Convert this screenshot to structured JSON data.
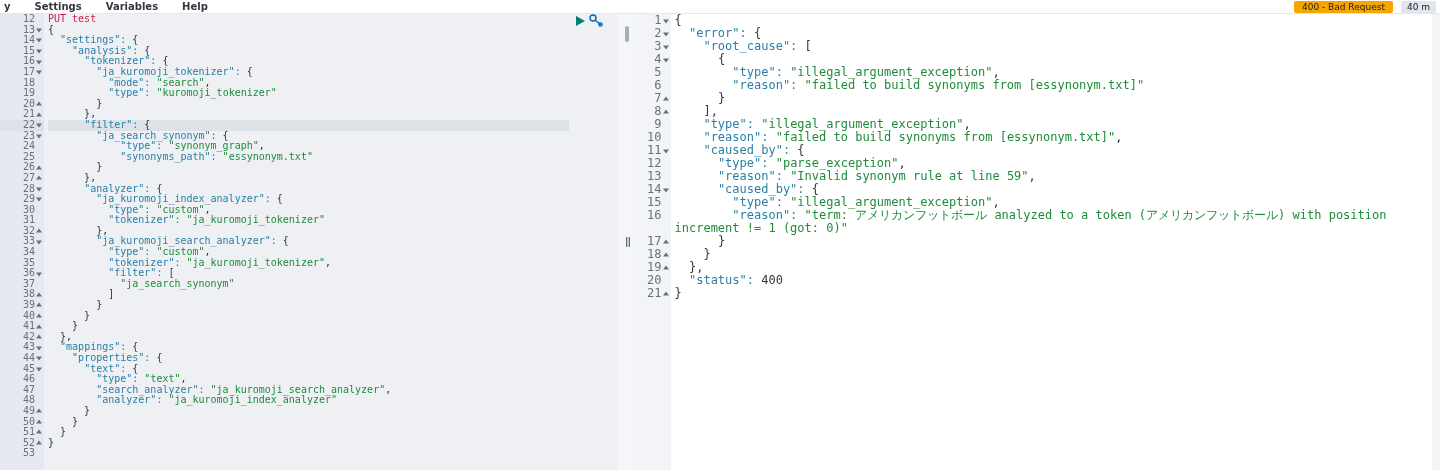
{
  "menu": [
    "y",
    "Settings",
    "Variables",
    "Help"
  ],
  "response_status": {
    "badge": "400 - Bad Request",
    "time": "40 m"
  },
  "request_editor": {
    "lines": [
      {
        "number": "12",
        "text": "PUT test",
        "kind": "request",
        "fold_open": false,
        "fold_close": false,
        "active": false
      },
      {
        "number": "13",
        "text": "{",
        "kind": "json",
        "fold_open": true,
        "fold_close": false,
        "active": false
      },
      {
        "number": "14",
        "text": "  \"settings\": {",
        "kind": "json",
        "fold_open": true,
        "fold_close": false,
        "active": false
      },
      {
        "number": "15",
        "text": "    \"analysis\": {",
        "kind": "json",
        "fold_open": true,
        "fold_close": false,
        "active": false
      },
      {
        "number": "16",
        "text": "      \"tokenizer\": {",
        "kind": "json",
        "fold_open": true,
        "fold_close": false,
        "active": false
      },
      {
        "number": "17",
        "text": "        \"ja_kuromoji_tokenizer\": {",
        "kind": "json",
        "fold_open": true,
        "fold_close": false,
        "active": false
      },
      {
        "number": "18",
        "text": "          \"mode\": \"search\",",
        "kind": "json",
        "fold_open": false,
        "fold_close": false,
        "active": false
      },
      {
        "number": "19",
        "text": "          \"type\": \"kuromoji_tokenizer\"",
        "kind": "json",
        "fold_open": false,
        "fold_close": false,
        "active": false
      },
      {
        "number": "20",
        "text": "        }",
        "kind": "json",
        "fold_open": false,
        "fold_close": true,
        "active": false
      },
      {
        "number": "21",
        "text": "      },",
        "kind": "json",
        "fold_open": false,
        "fold_close": true,
        "active": false
      },
      {
        "number": "22",
        "text": "      \"filter\": {",
        "kind": "json",
        "fold_open": true,
        "fold_close": false,
        "active": true
      },
      {
        "number": "23",
        "text": "        \"ja_search_synonym\": {",
        "kind": "json",
        "fold_open": true,
        "fold_close": false,
        "active": false
      },
      {
        "number": "24",
        "text": "            \"type\": \"synonym_graph\",",
        "kind": "json",
        "fold_open": false,
        "fold_close": false,
        "active": false
      },
      {
        "number": "25",
        "text": "            \"synonyms_path\": \"essynonym.txt\"",
        "kind": "json",
        "fold_open": false,
        "fold_close": false,
        "active": false
      },
      {
        "number": "26",
        "text": "        }",
        "kind": "json",
        "fold_open": false,
        "fold_close": true,
        "active": false
      },
      {
        "number": "27",
        "text": "      },",
        "kind": "json",
        "fold_open": false,
        "fold_close": true,
        "active": false
      },
      {
        "number": "28",
        "text": "      \"analyzer\": {",
        "kind": "json",
        "fold_open": true,
        "fold_close": false,
        "active": false
      },
      {
        "number": "29",
        "text": "        \"ja_kuromoji_index_analyzer\": {",
        "kind": "json",
        "fold_open": true,
        "fold_close": false,
        "active": false
      },
      {
        "number": "30",
        "text": "          \"type\": \"custom\",",
        "kind": "json",
        "fold_open": false,
        "fold_close": false,
        "active": false
      },
      {
        "number": "31",
        "text": "          \"tokenizer\": \"ja_kuromoji_tokenizer\"",
        "kind": "json",
        "fold_open": false,
        "fold_close": false,
        "active": false
      },
      {
        "number": "32",
        "text": "        },",
        "kind": "json",
        "fold_open": false,
        "fold_close": true,
        "active": false
      },
      {
        "number": "33",
        "text": "        \"ja_kuromoji_search_analyzer\": {",
        "kind": "json",
        "fold_open": true,
        "fold_close": false,
        "active": false
      },
      {
        "number": "34",
        "text": "          \"type\": \"custom\",",
        "kind": "json",
        "fold_open": false,
        "fold_close": false,
        "active": false
      },
      {
        "number": "35",
        "text": "          \"tokenizer\": \"ja_kuromoji_tokenizer\",",
        "kind": "json",
        "fold_open": false,
        "fold_close": false,
        "active": false
      },
      {
        "number": "36",
        "text": "          \"filter\": [",
        "kind": "json",
        "fold_open": true,
        "fold_close": false,
        "active": false
      },
      {
        "number": "37",
        "text": "            \"ja_search_synonym\"",
        "kind": "json",
        "fold_open": false,
        "fold_close": false,
        "active": false
      },
      {
        "number": "38",
        "text": "          ]",
        "kind": "json",
        "fold_open": false,
        "fold_close": true,
        "active": false
      },
      {
        "number": "39",
        "text": "        }",
        "kind": "json",
        "fold_open": false,
        "fold_close": true,
        "active": false
      },
      {
        "number": "40",
        "text": "      }",
        "kind": "json",
        "fold_open": false,
        "fold_close": true,
        "active": false
      },
      {
        "number": "41",
        "text": "    }",
        "kind": "json",
        "fold_open": false,
        "fold_close": true,
        "active": false
      },
      {
        "number": "42",
        "text": "  },",
        "kind": "json",
        "fold_open": false,
        "fold_close": true,
        "active": false
      },
      {
        "number": "43",
        "text": "  \"mappings\": {",
        "kind": "json",
        "fold_open": true,
        "fold_close": false,
        "active": false
      },
      {
        "number": "44",
        "text": "    \"properties\": {",
        "kind": "json",
        "fold_open": true,
        "fold_close": false,
        "active": false
      },
      {
        "number": "45",
        "text": "      \"text\": {",
        "kind": "json",
        "fold_open": true,
        "fold_close": false,
        "active": false
      },
      {
        "number": "46",
        "text": "        \"type\": \"text\",",
        "kind": "json",
        "fold_open": false,
        "fold_close": false,
        "active": false
      },
      {
        "number": "47",
        "text": "        \"search_analyzer\": \"ja_kuromoji_search_analyzer\",",
        "kind": "json",
        "fold_open": false,
        "fold_close": false,
        "active": false
      },
      {
        "number": "48",
        "text": "        \"analyzer\": \"ja_kuromoji_index_analyzer\"",
        "kind": "json",
        "fold_open": false,
        "fold_close": false,
        "active": false
      },
      {
        "number": "49",
        "text": "      }",
        "kind": "json",
        "fold_open": false,
        "fold_close": true,
        "active": false
      },
      {
        "number": "50",
        "text": "    }",
        "kind": "json",
        "fold_open": false,
        "fold_close": true,
        "active": false
      },
      {
        "number": "51",
        "text": "  }",
        "kind": "json",
        "fold_open": false,
        "fold_close": true,
        "active": false
      },
      {
        "number": "52",
        "text": "}",
        "kind": "json",
        "fold_open": false,
        "fold_close": true,
        "active": false
      },
      {
        "number": "53",
        "kind": "json",
        "fold_open": false,
        "fold_close": false,
        "active": false
      }
    ]
  },
  "response_editor": {
    "lines": [
      {
        "number": "1",
        "text": "{",
        "fold_open": true,
        "fold_close": false
      },
      {
        "number": "2",
        "text": "  \"error\": {",
        "fold_open": true,
        "fold_close": false
      },
      {
        "number": "3",
        "text": "    \"root_cause\": [",
        "fold_open": true,
        "fold_close": false
      },
      {
        "number": "4",
        "text": "      {",
        "fold_open": true,
        "fold_close": false
      },
      {
        "number": "5",
        "text": "        \"type\": \"illegal_argument_exception\",",
        "fold_open": false,
        "fold_close": false
      },
      {
        "number": "6",
        "text": "        \"reason\": \"failed to build synonyms from [essynonym.txt]\"",
        "fold_open": false,
        "fold_close": false
      },
      {
        "number": "7",
        "text": "      }",
        "fold_open": false,
        "fold_close": true
      },
      {
        "number": "8",
        "text": "    ],",
        "fold_open": false,
        "fold_close": true
      },
      {
        "number": "9",
        "text": "    \"type\": \"illegal_argument_exception\",",
        "fold_open": false,
        "fold_close": false
      },
      {
        "number": "10",
        "text": "    \"reason\": \"failed to build synonyms from [essynonym.txt]\",",
        "fold_open": false,
        "fold_close": false
      },
      {
        "number": "11",
        "text": "    \"caused_by\": {",
        "fold_open": true,
        "fold_close": false
      },
      {
        "number": "12",
        "text": "      \"type\": \"parse_exception\",",
        "fold_open": false,
        "fold_close": false
      },
      {
        "number": "13",
        "text": "      \"reason\": \"Invalid synonym rule at line 59\",",
        "fold_open": false,
        "fold_close": false
      },
      {
        "number": "14",
        "text": "      \"caused_by\": {",
        "fold_open": true,
        "fold_close": false
      },
      {
        "number": "15",
        "text": "        \"type\": \"illegal_argument_exception\",",
        "fold_open": false,
        "fold_close": false
      },
      {
        "number": "16",
        "text": "        \"reason\": \"term: アメリカンフットボール analyzed to a token (アメリカンフットボール) with position increment != 1 (got: 0)\"",
        "fold_open": false,
        "fold_close": false
      },
      {
        "number": "17",
        "text": "      }",
        "fold_open": false,
        "fold_close": true
      },
      {
        "number": "18",
        "text": "    }",
        "fold_open": false,
        "fold_close": true
      },
      {
        "number": "19",
        "text": "  },",
        "fold_open": false,
        "fold_close": true
      },
      {
        "number": "20",
        "text": "  \"status\": 400",
        "fold_open": false,
        "fold_close": false
      },
      {
        "number": "21",
        "text": "}",
        "fold_open": false,
        "fold_close": true
      }
    ]
  }
}
